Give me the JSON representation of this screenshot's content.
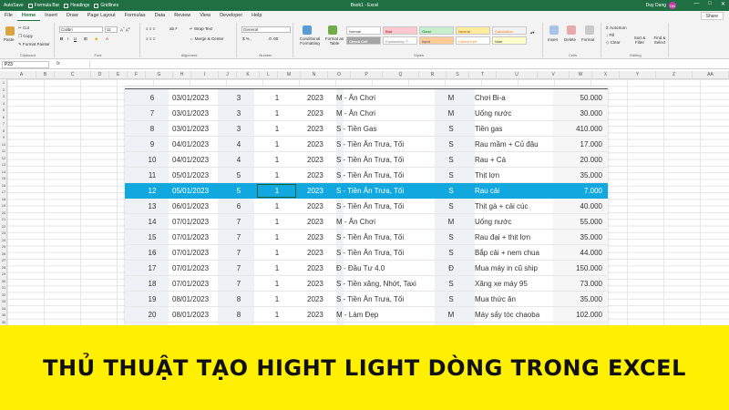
{
  "titlebar": {
    "autosave": "AutoSave",
    "qa_items": [
      "Formula Bar",
      "Headings",
      "Gridlines"
    ],
    "document": "Book1 - Excel",
    "user": "Duy Dang",
    "avatar": "DN",
    "window_buttons": [
      "—",
      "□",
      "✕"
    ]
  },
  "tabs": [
    "File",
    "Home",
    "Insert",
    "Draw",
    "Page Layout",
    "Formulas",
    "Data",
    "Review",
    "View",
    "Developer",
    "Help"
  ],
  "active_tab": "Home",
  "share": "Share",
  "ribbon": {
    "clipboard": {
      "paste": "Paste",
      "cut": "Cut",
      "copy": "Copy",
      "format_painter": "Format Painter",
      "name": "Clipboard"
    },
    "font": {
      "family": "Calibri",
      "size": "11",
      "name": "Font"
    },
    "alignment": {
      "wrap": "Wrap Text",
      "merge": "Merge & Center",
      "name": "Alignment"
    },
    "number": {
      "format": "General",
      "name": "Number"
    },
    "styles": {
      "conditional": "Conditional Formatting",
      "format_table": "Format as Table",
      "cells": [
        "Normal",
        "Bad",
        "Good",
        "Neutral",
        "Calculation",
        "Check Cell",
        "Explanatory T...",
        "Input",
        "Linked Cell",
        "Note"
      ],
      "name": "Styles"
    },
    "cells": {
      "insert": "Insert",
      "delete": "Delete",
      "format": "Format",
      "name": "Cells"
    },
    "editing": {
      "autosum": "AutoSum",
      "fill": "Fill",
      "clear": "Clear",
      "sort": "Sort & Filter",
      "find": "Find & Select",
      "name": "Editing"
    }
  },
  "formula_bar": {
    "name_box": "P23",
    "fx": "fx",
    "value": ""
  },
  "columns": [
    "A",
    "B",
    "C",
    "D",
    "E",
    "F",
    "G",
    "H",
    "I",
    "J",
    "K",
    "L",
    "M",
    "N",
    "O",
    "P",
    "Q",
    "R",
    "S",
    "T",
    "U",
    "V",
    "W",
    "X",
    "Y",
    "Z",
    "AA"
  ],
  "row_numbers": [
    "1",
    "2",
    "3",
    "4",
    "5",
    "6",
    "7",
    "8",
    "9",
    "10",
    "11",
    "12",
    "13",
    "14",
    "15",
    "16",
    "17",
    "18",
    "19",
    "20",
    "21",
    "22",
    "23",
    "24",
    "25",
    "26",
    "27",
    "28",
    "29",
    "30",
    "31",
    "32",
    "33",
    "34",
    "35",
    "36"
  ],
  "table_rows": [
    {
      "no": "6",
      "date": "03/01/2023",
      "day": "3",
      "month": "1",
      "year": "2023",
      "cat": "M - Ăn Chơi",
      "code": "M",
      "desc": "Chơi Bi-a",
      "amount": "50.000"
    },
    {
      "no": "7",
      "date": "03/01/2023",
      "day": "3",
      "month": "1",
      "year": "2023",
      "cat": "M - Ăn Chơi",
      "code": "M",
      "desc": "Uống nước",
      "amount": "30.000"
    },
    {
      "no": "8",
      "date": "03/01/2023",
      "day": "3",
      "month": "1",
      "year": "2023",
      "cat": "S - Tiền Gas",
      "code": "S",
      "desc": "Tiền gas",
      "amount": "410.000"
    },
    {
      "no": "9",
      "date": "04/01/2023",
      "day": "4",
      "month": "1",
      "year": "2023",
      "cat": "S - Tiền Ăn Trưa, Tối",
      "code": "S",
      "desc": "Rau mầm + Củ đậu",
      "amount": "17.000"
    },
    {
      "no": "10",
      "date": "04/01/2023",
      "day": "4",
      "month": "1",
      "year": "2023",
      "cat": "S - Tiền Ăn Trưa, Tối",
      "code": "S",
      "desc": "Rau + Cà",
      "amount": "20.000"
    },
    {
      "no": "11",
      "date": "05/01/2023",
      "day": "5",
      "month": "1",
      "year": "2023",
      "cat": "S - Tiền Ăn Trưa, Tối",
      "code": "S",
      "desc": "Thịt lợn",
      "amount": "35.000"
    },
    {
      "no": "12",
      "date": "05/01/2023",
      "day": "5",
      "month": "1",
      "year": "2023",
      "cat": "S - Tiền Ăn Trưa, Tối",
      "code": "S",
      "desc": "Rau cải",
      "amount": "7.000",
      "selected": true
    },
    {
      "no": "13",
      "date": "06/01/2023",
      "day": "6",
      "month": "1",
      "year": "2023",
      "cat": "S - Tiền Ăn Trưa, Tối",
      "code": "S",
      "desc": "Thịt gà + cải cúc",
      "amount": "40.000"
    },
    {
      "no": "14",
      "date": "07/01/2023",
      "day": "7",
      "month": "1",
      "year": "2023",
      "cat": "M - Ăn Chơi",
      "code": "M",
      "desc": "Uống nước",
      "amount": "55.000"
    },
    {
      "no": "15",
      "date": "07/01/2023",
      "day": "7",
      "month": "1",
      "year": "2023",
      "cat": "S - Tiền Ăn Trưa, Tối",
      "code": "S",
      "desc": "Rau đại + thịt lợn",
      "amount": "35.000"
    },
    {
      "no": "16",
      "date": "07/01/2023",
      "day": "7",
      "month": "1",
      "year": "2023",
      "cat": "S - Tiền Ăn Trưa, Tối",
      "code": "S",
      "desc": "Bắp cải + nem chua",
      "amount": "44.000"
    },
    {
      "no": "17",
      "date": "07/01/2023",
      "day": "7",
      "month": "1",
      "year": "2023",
      "cat": "Đ - Đầu Tư 4.0",
      "code": "Đ",
      "desc": "Mua máy in cũ ship",
      "amount": "150.000"
    },
    {
      "no": "18",
      "date": "07/01/2023",
      "day": "7",
      "month": "1",
      "year": "2023",
      "cat": "S - Tiền xăng, Nhớt, Taxi",
      "code": "S",
      "desc": "Xăng xe máy 95",
      "amount": "73.000"
    },
    {
      "no": "19",
      "date": "08/01/2023",
      "day": "8",
      "month": "1",
      "year": "2023",
      "cat": "S - Tiền Ăn Trưa, Tối",
      "code": "S",
      "desc": "Mua thức ăn",
      "amount": "35.000"
    },
    {
      "no": "20",
      "date": "08/01/2023",
      "day": "8",
      "month": "1",
      "year": "2023",
      "cat": "M - Làm Đẹp",
      "code": "M",
      "desc": "Máy sấy tóc chaoba",
      "amount": "102.000"
    }
  ],
  "banner": "THỦ THUẬT TẠO HIGHT LIGHT DÒNG TRONG EXCEL",
  "colors": {
    "excel_green": "#1f6f43",
    "highlight": "#11a8e0",
    "banner": "#ffef00"
  }
}
